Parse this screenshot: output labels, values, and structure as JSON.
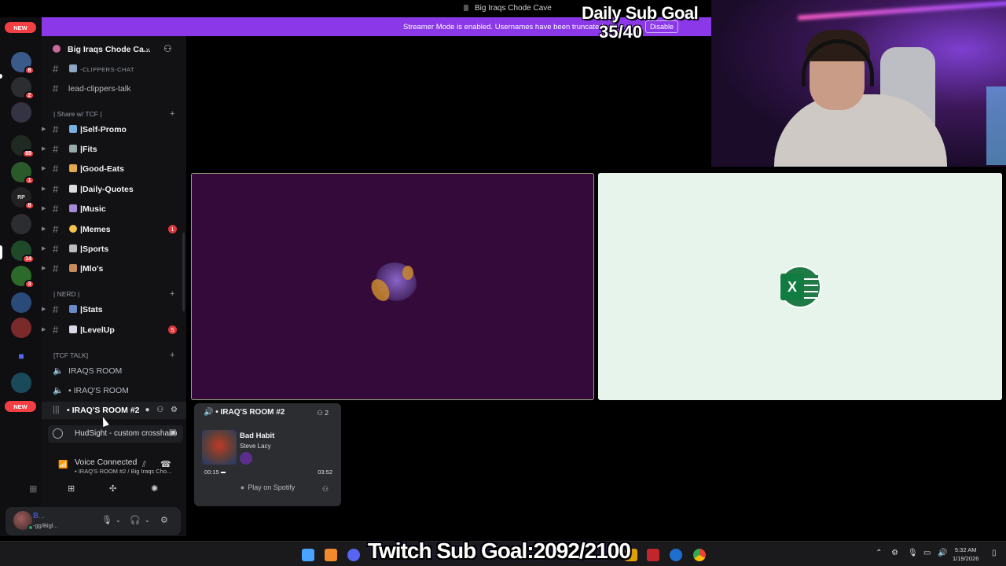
{
  "window": {
    "title": "Big Iraqs Chode Cave"
  },
  "banner": {
    "message": "Streamer Mode is enabled. Usernames have been truncated.",
    "disable_label": "Disable"
  },
  "overlay": {
    "daily_goal_title": "Daily Sub Goal",
    "daily_goal_value": "35/40",
    "twitch_goal": "Twitch Sub Goal:2092/2100"
  },
  "server_rail": {
    "new_top": "NEW",
    "new_bottom": "NEW",
    "servers": [
      {
        "badge": "8"
      },
      {
        "badge": "2"
      },
      {
        "badge": ""
      },
      {
        "badge": "85"
      },
      {
        "badge": "1"
      },
      {
        "badge": "8",
        "label": "RP"
      },
      {
        "badge": ""
      },
      {
        "badge": "14"
      },
      {
        "badge": "3"
      },
      {
        "badge": ""
      },
      {
        "badge": ""
      },
      {
        "badge": ""
      },
      {
        "badge": ""
      },
      {
        "badge": "7"
      }
    ]
  },
  "server": {
    "name": "Big Iraqs Chode Ca..."
  },
  "channels": {
    "clippers_chat": "-CLIPPERS-CHAT",
    "lead_clippers": "lead-clippers-talk",
    "cat_share": "| Share w/ TCF |",
    "self_promo": "|Self-Promo",
    "fits": "|Fits",
    "good_eats": "|Good-Eats",
    "daily_quotes": "|Daily-Quotes",
    "music": "|Music",
    "memes": "|Memes",
    "memes_count": "1",
    "sports": "|Sports",
    "mlos": "|Mlo's",
    "cat_nerd": "| NERD |",
    "stats": "|Stats",
    "levelup": "|LevelUp",
    "levelup_count": "5",
    "cat_talk": "[TCF TALK]",
    "iraqs_room_1": "IRAQS ROOM",
    "iraqs_room_2": "• IRAQ'S ROOM",
    "iraqs_room_3": "• IRAQ'S ROOM #2"
  },
  "activity": {
    "text": "HudSight - custom crosshair ov..."
  },
  "voice": {
    "status": "Voice Connected",
    "location": "• IRAQ'S ROOM #2 / Big Iraqs Cho..."
  },
  "user": {
    "name": "B...",
    "sub": "-gg/Bigl..."
  },
  "spotify": {
    "channel": "• IRAQ'S ROOM #2",
    "listeners": "2",
    "song": "Bad Habit",
    "artist": "Steve Lacy",
    "elapsed": "00:15",
    "duration": "03:52",
    "play_label": "Play on Spotify",
    "progress": 0.065
  },
  "taskbar": {
    "time": "5:32 AM",
    "date": "1/19/2026"
  },
  "colors": {
    "accent": "#8b38e8",
    "tile_user": "#330a39",
    "tile_screen": "#e6f4ec",
    "badge": "#f23f43"
  },
  "icons": [
    "speaker-icon",
    "hash-icon",
    "gear-icon",
    "headphones-icon",
    "microphone-icon",
    "excel-icon",
    "spotify-icon"
  ]
}
